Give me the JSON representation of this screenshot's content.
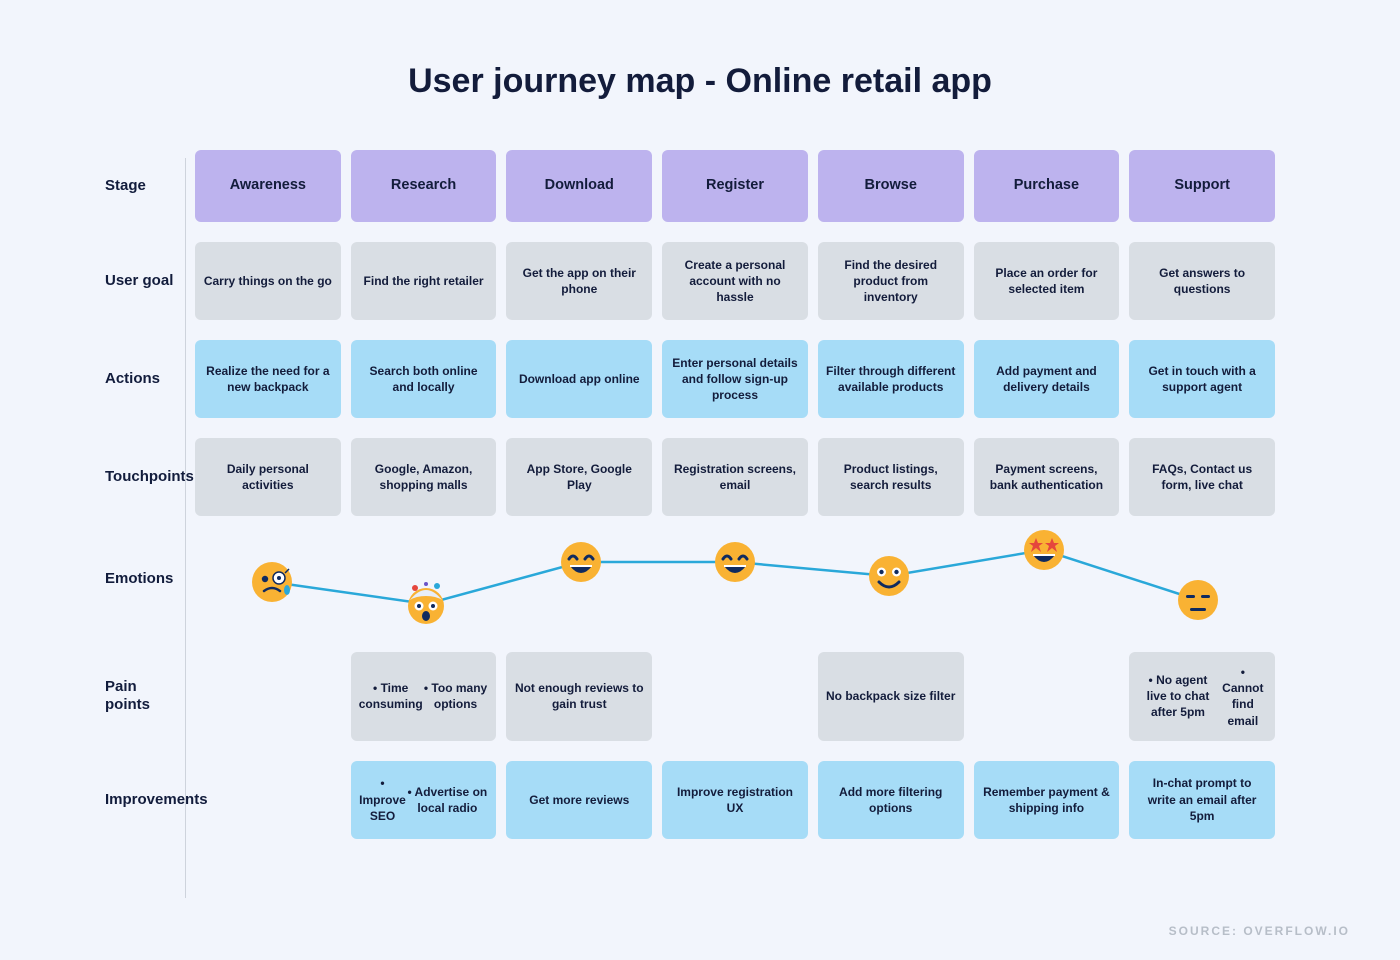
{
  "title": "User journey map - Online retail app",
  "rows": {
    "stage": "Stage",
    "usergoal": "User goal",
    "actions": "Actions",
    "touchpoints": "Touchpoints",
    "emotions": "Emotions",
    "painpoints": "Pain points",
    "improvements": "Improvements"
  },
  "stages": [
    "Awareness",
    "Research",
    "Download",
    "Register",
    "Browse",
    "Purchase",
    "Support"
  ],
  "usergoal": [
    "Carry things on the go",
    "Find the right retailer",
    "Get the app on their phone",
    "Create a personal account with no hassle",
    "Find the desired product from inventory",
    "Place an order for selected item",
    "Get answers to questions"
  ],
  "actions": [
    "Realize the need for a new backpack",
    "Search both online and locally",
    "Download app online",
    "Enter personal details and follow sign-up process",
    "Filter through different available products",
    "Add payment and delivery details",
    "Get in touch with a support agent"
  ],
  "touchpoints": [
    "Daily personal activities",
    "Google, Amazon, shopping malls",
    "App Store, Google Play",
    "Registration screens, email",
    "Product listings, search results",
    "Payment screens, bank authentication",
    "FAQs, Contact us form, live chat"
  ],
  "painpoints": [
    "",
    "• Time consuming\n• Too many options",
    "Not enough reviews to gain trust",
    "",
    "No backpack size filter",
    "",
    "• No agent live to chat after 5pm\n• Cannot find email"
  ],
  "improvements": [
    "",
    "• Improve SEO\n• Advertise on local radio",
    "Get more reviews",
    "Improve registration UX",
    "Add more filtering options",
    "Remember payment & shipping info",
    "In-chat prompt to write an email after 5pm"
  ],
  "emotions": [
    {
      "name": "worried-face-icon",
      "y": 46
    },
    {
      "name": "exploding-head-icon",
      "y": 68
    },
    {
      "name": "happy-face-icon",
      "y": 26
    },
    {
      "name": "happy-face-icon",
      "y": 26
    },
    {
      "name": "smile-face-icon",
      "y": 40
    },
    {
      "name": "star-eyes-icon",
      "y": 14
    },
    {
      "name": "unamused-face-icon",
      "y": 64
    }
  ],
  "source": "SOURCE: OVERFLOW.IO"
}
